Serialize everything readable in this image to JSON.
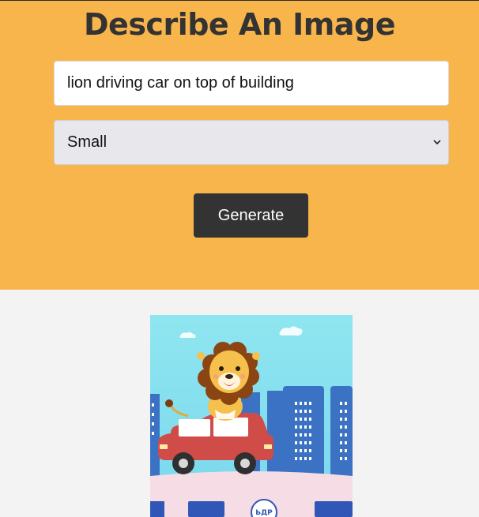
{
  "page": {
    "title": "Describe An Image"
  },
  "form": {
    "prompt_value": "lion driving car on top of building",
    "size_selected": "Small",
    "generate_label": "Generate"
  },
  "colors": {
    "hero_background": "#f8b54c",
    "page_background": "#f3f3f3",
    "button_background": "#333333",
    "title_color": "#333333"
  },
  "result_image": {
    "icon": "generated-image",
    "badge_text": "ЬДР"
  }
}
